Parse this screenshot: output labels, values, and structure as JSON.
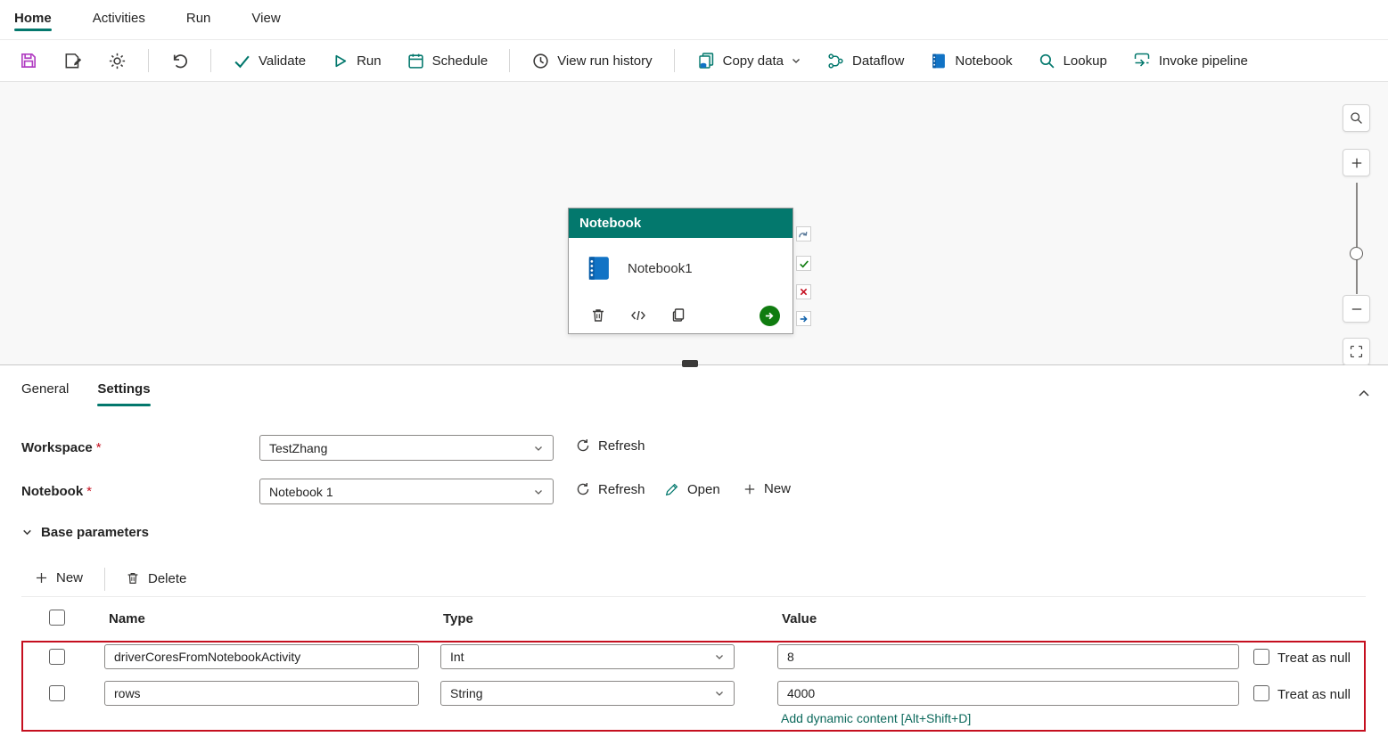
{
  "menubar": {
    "items": [
      {
        "label": "Home"
      },
      {
        "label": "Activities"
      },
      {
        "label": "Run"
      },
      {
        "label": "View"
      }
    ]
  },
  "toolbar": {
    "validate_label": "Validate",
    "run_label": "Run",
    "schedule_label": "Schedule",
    "view_run_history_label": "View run history",
    "copy_data_label": "Copy data",
    "dataflow_label": "Dataflow",
    "notebook_label": "Notebook",
    "lookup_label": "Lookup",
    "invoke_pipeline_label": "Invoke pipeline"
  },
  "canvas": {
    "activity": {
      "type_header": "Notebook",
      "name": "Notebook1"
    }
  },
  "panel": {
    "tabs": {
      "general": "General",
      "settings": "Settings"
    },
    "workspace": {
      "label": "Workspace",
      "required": "*",
      "value": "TestZhang",
      "refresh": "Refresh"
    },
    "notebook": {
      "label": "Notebook",
      "required": "*",
      "value": "Notebook 1",
      "refresh": "Refresh",
      "open": "Open",
      "new": "New"
    },
    "base_parameters": {
      "label": "Base parameters"
    },
    "params_toolbar": {
      "new": "New",
      "delete": "Delete"
    },
    "table": {
      "headers": {
        "name": "Name",
        "type": "Type",
        "value": "Value"
      },
      "rows": [
        {
          "name": "driverCoresFromNotebookActivity",
          "type": "Int",
          "value": "8",
          "treat_as_null": "Treat as null"
        },
        {
          "name": "rows",
          "type": "String",
          "value": "4000",
          "treat_as_null": "Treat as null"
        }
      ],
      "add_dynamic_content": "Add dynamic content [Alt+Shift+D]"
    }
  },
  "colors": {
    "accent_teal": "#03786d",
    "highlight_red": "#c50f1f",
    "notebook_blue": "#1173c5",
    "save_purple": "#b13dc2",
    "success_green": "#107c10",
    "link_teal": "#0c695c"
  }
}
